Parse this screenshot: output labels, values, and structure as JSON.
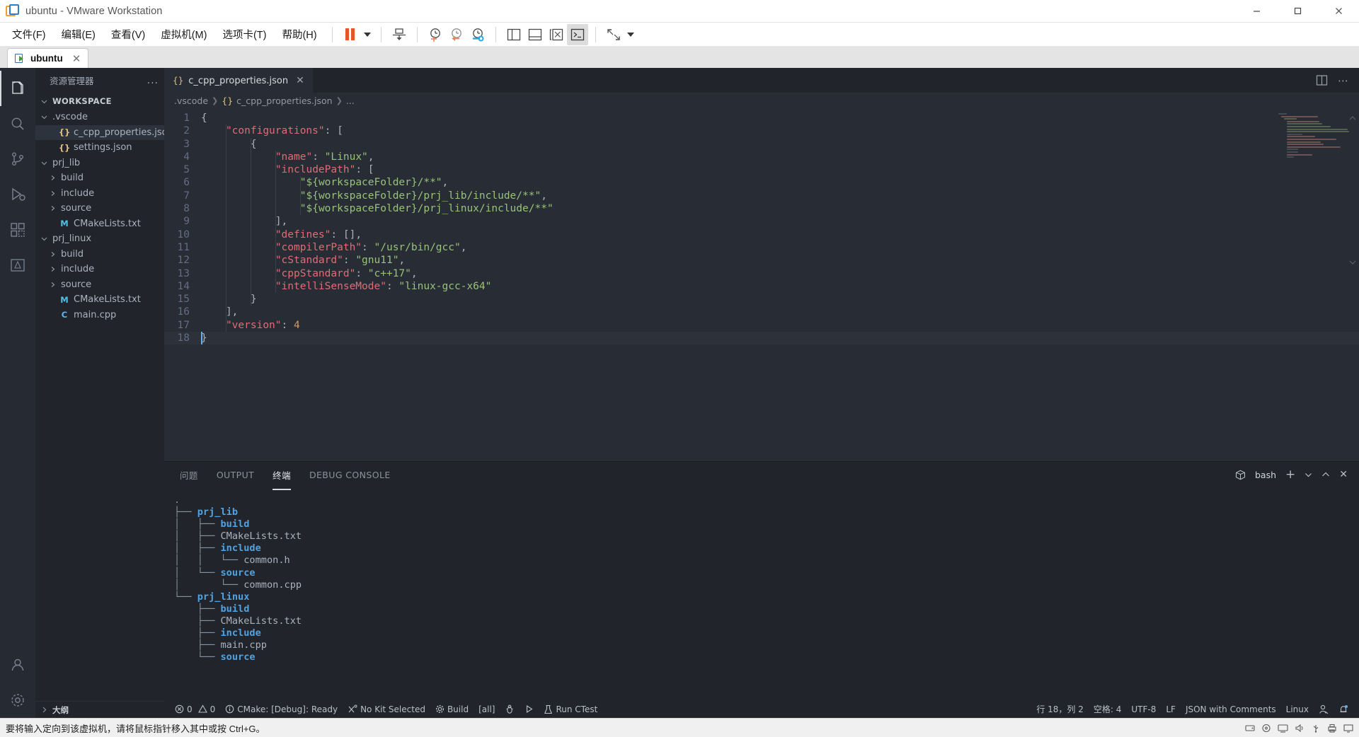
{
  "vmware": {
    "title": "ubuntu - VMware Workstation",
    "logo_icon": "vmware-logo-icon",
    "window_buttons": [
      {
        "name": "minimize-button",
        "icon": "minimize-icon"
      },
      {
        "name": "maximize-button",
        "icon": "maximize-icon"
      },
      {
        "name": "close-button",
        "icon": "close-icon"
      }
    ],
    "menus": [
      {
        "label": "文件(F)",
        "name": "menu-file"
      },
      {
        "label": "编辑(E)",
        "name": "menu-edit"
      },
      {
        "label": "查看(V)",
        "name": "menu-view"
      },
      {
        "label": "虚拟机(M)",
        "name": "menu-vm"
      },
      {
        "label": "选项卡(T)",
        "name": "menu-tabs"
      },
      {
        "label": "帮助(H)",
        "name": "menu-help"
      }
    ],
    "toolbar": [
      {
        "name": "pause-button",
        "icon": "pause-icon"
      },
      {
        "name": "pause-dropdown",
        "icon": "chevron-down-icon"
      },
      {
        "name": "send-ctrl-alt-del-button",
        "icon": "send-key-icon"
      },
      {
        "name": "take-snapshot-button",
        "icon": "snapshot-add-icon"
      },
      {
        "name": "revert-snapshot-button",
        "icon": "snapshot-revert-icon"
      },
      {
        "name": "snapshot-manager-button",
        "icon": "snapshot-manager-icon"
      },
      {
        "name": "show-library-button",
        "icon": "panel-left-icon"
      },
      {
        "name": "show-thumbnails-button",
        "icon": "panel-bottom-icon"
      },
      {
        "name": "show-console-button",
        "icon": "panel-console-icon"
      },
      {
        "name": "unity-mode-button",
        "icon": "terminal-icon"
      },
      {
        "name": "fullscreen-button",
        "icon": "fullscreen-icon"
      },
      {
        "name": "fullscreen-dropdown",
        "icon": "chevron-down-icon"
      }
    ],
    "vm_tab": {
      "label": "ubuntu",
      "icon": "vm-running-icon",
      "close_icon": "close-icon"
    },
    "status_hint": "要将输入定向到该虚拟机，请将鼠标指针移入其中或按 Ctrl+G。",
    "status_icons": [
      "hdd-icon",
      "cd-icon",
      "network-icon",
      "sound-icon",
      "usb-icon",
      "printer-icon",
      "display-icon"
    ]
  },
  "vscode": {
    "activitybar": [
      {
        "name": "sidebar-item-explorer",
        "icon": "files-icon",
        "active": true
      },
      {
        "name": "sidebar-item-search",
        "icon": "search-icon",
        "active": false
      },
      {
        "name": "sidebar-item-source-control",
        "icon": "source-control-icon",
        "active": false
      },
      {
        "name": "sidebar-item-run-debug",
        "icon": "run-debug-icon",
        "active": false
      },
      {
        "name": "sidebar-item-extensions",
        "icon": "extensions-icon",
        "active": false
      },
      {
        "name": "sidebar-item-cmake",
        "icon": "cmake-icon",
        "active": false
      },
      {
        "name": "sidebar-item-accounts",
        "icon": "account-icon",
        "active": false
      },
      {
        "name": "sidebar-item-settings",
        "icon": "gear-icon",
        "active": false
      }
    ],
    "explorer": {
      "title": "资源管理器",
      "more_actions": "...",
      "workspace_label": "WORKSPACE",
      "outline_label": "大纲",
      "tree": [
        {
          "label": ".vscode",
          "indent": 1,
          "kind": "folder",
          "expanded": true,
          "icon": "chevron-down-icon",
          "selected": false
        },
        {
          "label": "c_cpp_properties.json",
          "indent": 2,
          "kind": "json",
          "expanded": null,
          "icon": "json-icon",
          "selected": true
        },
        {
          "label": "settings.json",
          "indent": 2,
          "kind": "json",
          "expanded": null,
          "icon": "json-icon",
          "selected": false
        },
        {
          "label": "prj_lib",
          "indent": 1,
          "kind": "folder",
          "expanded": true,
          "icon": "chevron-down-icon",
          "selected": false
        },
        {
          "label": "build",
          "indent": 2,
          "kind": "folder",
          "expanded": false,
          "icon": "chevron-right-icon",
          "selected": false
        },
        {
          "label": "include",
          "indent": 2,
          "kind": "folder",
          "expanded": false,
          "icon": "chevron-right-icon",
          "selected": false
        },
        {
          "label": "source",
          "indent": 2,
          "kind": "folder",
          "expanded": false,
          "icon": "chevron-right-icon",
          "selected": false
        },
        {
          "label": "CMakeLists.txt",
          "indent": 2,
          "kind": "cmake",
          "expanded": null,
          "icon": "cmake-m-icon",
          "selected": false
        },
        {
          "label": "prj_linux",
          "indent": 1,
          "kind": "folder",
          "expanded": true,
          "icon": "chevron-down-icon",
          "selected": false
        },
        {
          "label": "build",
          "indent": 2,
          "kind": "folder",
          "expanded": false,
          "icon": "chevron-right-icon",
          "selected": false
        },
        {
          "label": "include",
          "indent": 2,
          "kind": "folder",
          "expanded": false,
          "icon": "chevron-right-icon",
          "selected": false
        },
        {
          "label": "source",
          "indent": 2,
          "kind": "folder",
          "expanded": false,
          "icon": "chevron-right-icon",
          "selected": false
        },
        {
          "label": "CMakeLists.txt",
          "indent": 2,
          "kind": "cmake",
          "expanded": null,
          "icon": "cmake-m-icon",
          "selected": false
        },
        {
          "label": "main.cpp",
          "indent": 2,
          "kind": "cpp",
          "expanded": null,
          "icon": "cpp-icon",
          "selected": false
        }
      ]
    },
    "editor": {
      "tab": {
        "label": "c_cpp_properties.json",
        "icon": "json-icon",
        "close_icon": "close-icon",
        "active": true
      },
      "tab_actions": [
        {
          "name": "split-editor-button",
          "icon": "split-editor-icon"
        },
        {
          "name": "editor-more-actions-button",
          "icon": "ellipsis-icon"
        }
      ],
      "breadcrumb": [
        ".vscode",
        "c_cpp_properties.json",
        "..."
      ],
      "code_lines": [
        {
          "n": "1",
          "text": "{",
          "cursor": false
        },
        {
          "n": "2",
          "text": "    \"configurations\": [",
          "cursor": false
        },
        {
          "n": "3",
          "text": "        {",
          "cursor": false
        },
        {
          "n": "4",
          "text": "            \"name\": \"Linux\",",
          "cursor": false
        },
        {
          "n": "5",
          "text": "            \"includePath\": [",
          "cursor": false
        },
        {
          "n": "6",
          "text": "                \"${workspaceFolder}/**\",",
          "cursor": false
        },
        {
          "n": "7",
          "text": "                \"${workspaceFolder}/prj_lib/include/**\",",
          "cursor": false
        },
        {
          "n": "8",
          "text": "                \"${workspaceFolder}/prj_linux/include/**\"",
          "cursor": false
        },
        {
          "n": "9",
          "text": "            ],",
          "cursor": false
        },
        {
          "n": "10",
          "text": "            \"defines\": [],",
          "cursor": false
        },
        {
          "n": "11",
          "text": "            \"compilerPath\": \"/usr/bin/gcc\",",
          "cursor": false
        },
        {
          "n": "12",
          "text": "            \"cStandard\": \"gnu11\",",
          "cursor": false
        },
        {
          "n": "13",
          "text": "            \"cppStandard\": \"c++17\",",
          "cursor": false
        },
        {
          "n": "14",
          "text": "            \"intelliSenseMode\": \"linux-gcc-x64\"",
          "cursor": false
        },
        {
          "n": "15",
          "text": "        }",
          "cursor": false
        },
        {
          "n": "16",
          "text": "    ],",
          "cursor": false
        },
        {
          "n": "17",
          "text": "    \"version\": 4",
          "cursor": false
        },
        {
          "n": "18",
          "text": "}",
          "cursor": true
        }
      ]
    },
    "panel": {
      "tabs": [
        {
          "label": "问题",
          "name": "tab-problems",
          "active": false
        },
        {
          "label": "OUTPUT",
          "name": "tab-output",
          "active": false
        },
        {
          "label": "终端",
          "name": "tab-terminal",
          "active": true
        },
        {
          "label": "DEBUG CONSOLE",
          "name": "tab-debug-console",
          "active": false
        }
      ],
      "shell": "bash",
      "actions": [
        {
          "name": "terminal-shell-icon",
          "icon": "cube-icon"
        },
        {
          "name": "new-terminal-button",
          "icon": "plus-icon"
        },
        {
          "name": "terminal-dropdown-button",
          "icon": "chevron-down-icon"
        },
        {
          "name": "maximize-panel-button",
          "icon": "chevron-up-icon"
        },
        {
          "name": "close-panel-button",
          "icon": "close-icon"
        }
      ],
      "terminal_lines": [
        {
          "prefix": "",
          "tree": ".",
          "name": "",
          "dir": false
        },
        {
          "prefix": "",
          "tree": "├── ",
          "name": "prj_lib",
          "dir": true
        },
        {
          "prefix": "",
          "tree": "│   ├── ",
          "name": "build",
          "dir": true
        },
        {
          "prefix": "",
          "tree": "│   ├── ",
          "name": "CMakeLists.txt",
          "dir": false
        },
        {
          "prefix": "",
          "tree": "│   ├── ",
          "name": "include",
          "dir": true
        },
        {
          "prefix": "",
          "tree": "│   │   └── ",
          "name": "common.h",
          "dir": false
        },
        {
          "prefix": "",
          "tree": "│   └── ",
          "name": "source",
          "dir": true
        },
        {
          "prefix": "",
          "tree": "│       └── ",
          "name": "common.cpp",
          "dir": false
        },
        {
          "prefix": "",
          "tree": "└── ",
          "name": "prj_linux",
          "dir": true
        },
        {
          "prefix": "",
          "tree": "    ├── ",
          "name": "build",
          "dir": true
        },
        {
          "prefix": "",
          "tree": "    ├── ",
          "name": "CMakeLists.txt",
          "dir": false
        },
        {
          "prefix": "",
          "tree": "    ├── ",
          "name": "include",
          "dir": true
        },
        {
          "prefix": "",
          "tree": "    ├── ",
          "name": "main.cpp",
          "dir": false
        },
        {
          "prefix": "",
          "tree": "    └── ",
          "name": "source",
          "dir": true
        }
      ]
    },
    "statusbar": {
      "left": [
        {
          "name": "problems-status",
          "icon": "error-icon",
          "label": "0",
          "icon2": "warning-icon",
          "label2": "0"
        },
        {
          "name": "cmake-status",
          "icon": "info-icon",
          "label": "CMake: [Debug]: Ready"
        },
        {
          "name": "kit-status",
          "icon": "tools-icon",
          "label": "No Kit Selected"
        },
        {
          "name": "build-status",
          "icon": "gear-icon",
          "label": "Build"
        },
        {
          "name": "target-status",
          "icon": "",
          "label": "[all]"
        },
        {
          "name": "debug-status",
          "icon": "bug-icon",
          "label": ""
        },
        {
          "name": "launch-status",
          "icon": "play-icon",
          "label": ""
        },
        {
          "name": "ctest-status",
          "icon": "beaker-icon",
          "label": "Run CTest"
        }
      ],
      "right": [
        {
          "name": "cursor-position-status",
          "label": "行 18，列 2"
        },
        {
          "name": "indentation-status",
          "label": "空格: 4"
        },
        {
          "name": "encoding-status",
          "label": "UTF-8"
        },
        {
          "name": "eol-status",
          "label": "LF"
        },
        {
          "name": "language-mode-status",
          "label": "JSON with Comments"
        },
        {
          "name": "remote-status",
          "label": "Linux"
        },
        {
          "name": "feedback-status",
          "label": "",
          "icon": "feedback-icon"
        },
        {
          "name": "notifications-status",
          "label": "",
          "icon": "bell-icon"
        }
      ]
    }
  },
  "colors": {
    "editor_bg": "#282c34",
    "sidebar_bg": "#21252b",
    "activitybar_bg": "#262b33",
    "accent": "#61afef",
    "string_green": "#98c379",
    "key_red": "#e06c75",
    "json_yellow": "#e5c07b",
    "terminal_dir_blue": "#4fa3e3"
  }
}
